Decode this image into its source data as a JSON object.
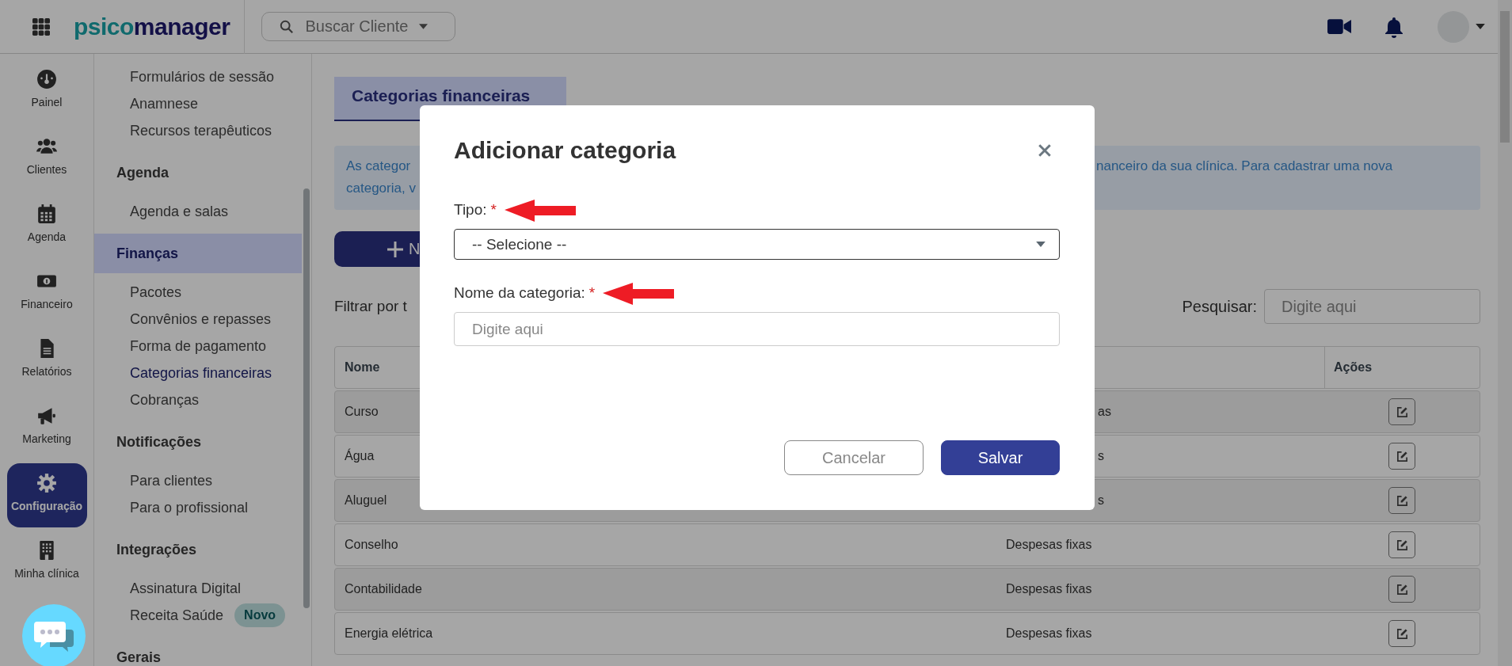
{
  "top_bar": {
    "logo": [
      "psico",
      "manager"
    ],
    "search": {
      "placeholder": "Buscar Cliente"
    }
  },
  "rail": [
    {
      "label": "Painel",
      "selected": false
    },
    {
      "label": "Clientes",
      "selected": false
    },
    {
      "label": "Agenda",
      "selected": false
    },
    {
      "label": "Financeiro",
      "selected": false
    },
    {
      "label": "Relatórios",
      "selected": false
    },
    {
      "label": "Marketing",
      "selected": false
    },
    {
      "label": "Configuração",
      "selected": true
    },
    {
      "label": "Minha clínica",
      "selected": false
    }
  ],
  "submenu": [
    {
      "kind": "item",
      "label": "Formulários de sessão",
      "selected": false
    },
    {
      "kind": "item",
      "label": "Anamnese",
      "selected": false
    },
    {
      "kind": "item",
      "label": "Recursos terapêuticos",
      "selected": false
    },
    {
      "kind": "header",
      "label": "Agenda",
      "selected": false
    },
    {
      "kind": "item",
      "label": "Agenda e salas",
      "selected": false
    },
    {
      "kind": "header",
      "label": "Finanças",
      "selected": true
    },
    {
      "kind": "item",
      "label": "Pacotes",
      "selected": false
    },
    {
      "kind": "item",
      "label": "Convênios e repasses",
      "selected": false
    },
    {
      "kind": "item",
      "label": "Forma de pagamento",
      "selected": false
    },
    {
      "kind": "item",
      "label": "Categorias financeiras",
      "selected": true
    },
    {
      "kind": "item",
      "label": "Cobranças",
      "selected": false
    },
    {
      "kind": "header",
      "label": "Notificações",
      "selected": false
    },
    {
      "kind": "item",
      "label": "Para clientes",
      "selected": false
    },
    {
      "kind": "item",
      "label": "Para o profissional",
      "selected": false
    },
    {
      "kind": "header",
      "label": "Integrações",
      "selected": false
    },
    {
      "kind": "item",
      "label": "Assinatura Digital",
      "selected": false
    },
    {
      "kind": "item",
      "label": "Receita Saúde",
      "selected": false,
      "badge": "Novo"
    },
    {
      "kind": "header",
      "label": "Gerais",
      "selected": false
    }
  ],
  "page": {
    "tab": {
      "label": "Categorias financeiras",
      "selected": true
    },
    "info": {
      "left_lines": [
        "As categor",
        "categoria, v"
      ],
      "right_lines": [
        "nanceiro da sua clínica. Para cadastrar uma nova"
      ]
    },
    "new_button": "N",
    "filter_label": "Filtrar por t",
    "search": {
      "label": "Pesquisar:",
      "placeholder": "Digite aqui"
    },
    "table": {
      "columns": [
        "Nome",
        "Ações"
      ],
      "rows": [
        {
          "name": "Curso",
          "type_tail": "as"
        },
        {
          "name": "Água",
          "type_tail": "s"
        },
        {
          "name": "Aluguel",
          "type_tail": "s"
        },
        {
          "name": "Conselho",
          "type": "Despesas fixas"
        },
        {
          "name": "Contabilidade",
          "type": "Despesas fixas"
        },
        {
          "name": "Energia elétrica",
          "type": "Despesas fixas"
        }
      ]
    }
  },
  "dialog": {
    "title": "Adicionar categoria",
    "fields": [
      {
        "kind": "select",
        "label": "Tipo:",
        "mark": "*",
        "value": "-- Selecione --"
      },
      {
        "kind": "input",
        "label": "Nome da categoria:",
        "mark": "*",
        "placeholder": "Digite aqui"
      }
    ],
    "buttons": [
      {
        "kind": "secondary",
        "label": "Cancelar"
      },
      {
        "kind": "primary",
        "label": "Salvar"
      }
    ]
  }
}
